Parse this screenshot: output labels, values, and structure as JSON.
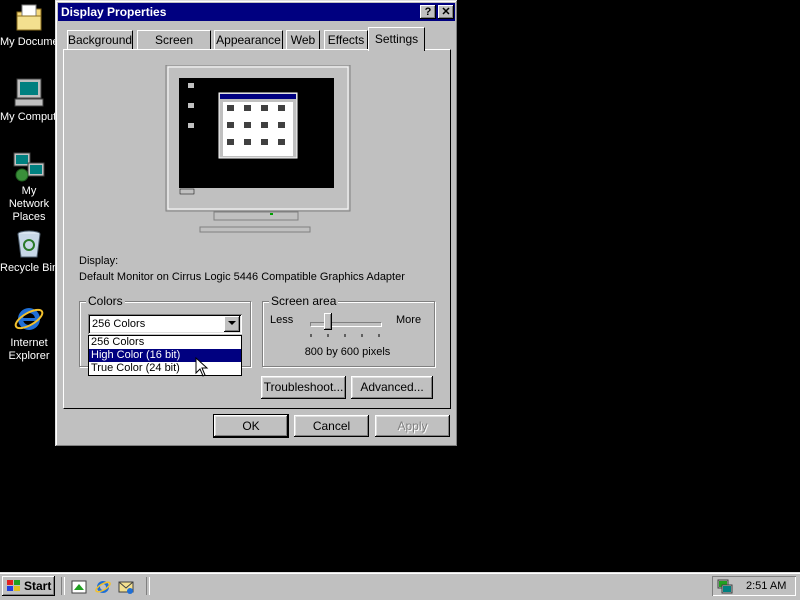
{
  "desktop": {
    "icons": [
      {
        "label": "My Documents",
        "icon": "folder-documents-icon"
      },
      {
        "label": "My Computer",
        "icon": "computer-icon"
      },
      {
        "label": "My Network Places",
        "icon": "network-icon"
      },
      {
        "label": "Recycle Bin",
        "icon": "recycle-bin-icon"
      },
      {
        "label": "Internet Explorer",
        "icon": "internet-explorer-icon"
      }
    ]
  },
  "dialog": {
    "title": "Display Properties",
    "help_label": "?",
    "close_label": "✕",
    "tabs": [
      "Background",
      "Screen Saver",
      "Appearance",
      "Web",
      "Effects",
      "Settings"
    ],
    "active_tab": "Settings",
    "display_label": "Display:",
    "display_value": "Default Monitor on Cirrus Logic 5446 Compatible Graphics Adapter",
    "colors": {
      "group_label": "Colors",
      "selected": "256 Colors",
      "options": [
        "256 Colors",
        "High Color (16 bit)",
        "True Color (24 bit)"
      ],
      "highlighted": "High Color (16 bit)"
    },
    "screen_area": {
      "group_label": "Screen area",
      "less_label": "Less",
      "more_label": "More",
      "value_text": "800 by 600 pixels",
      "slider_level": 0.25
    },
    "buttons": {
      "troubleshoot": "Troubleshoot...",
      "advanced": "Advanced...",
      "ok": "OK",
      "cancel": "Cancel",
      "apply": "Apply"
    }
  },
  "taskbar": {
    "start_label": "Start",
    "quick_launch": [
      "show-desktop-icon",
      "internet-explorer-icon",
      "outlook-express-icon"
    ],
    "clock": "2:51 AM"
  }
}
